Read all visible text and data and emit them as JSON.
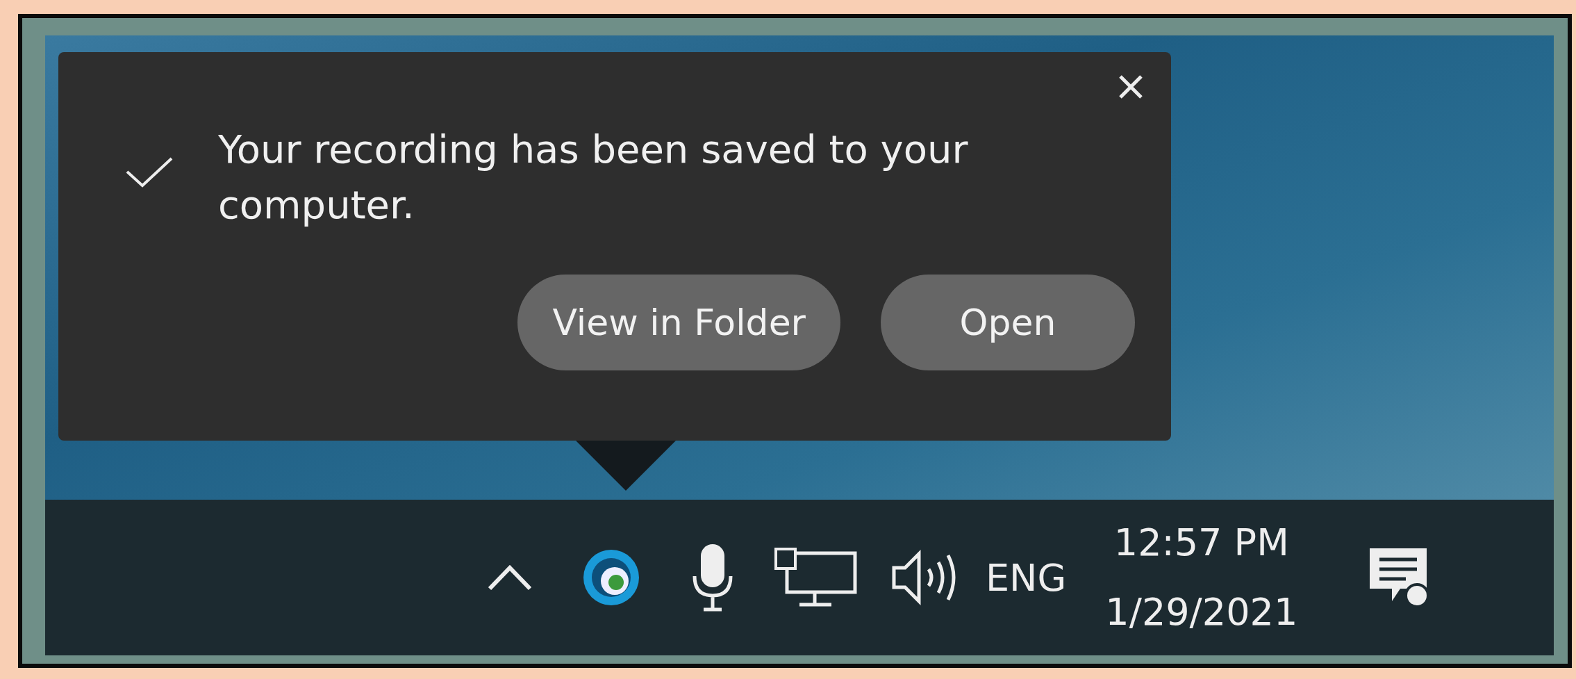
{
  "notification": {
    "message": "Your recording has been saved to your computer.",
    "buttons": [
      "View in Folder",
      "Open"
    ]
  },
  "taskbar": {
    "language": "ENG",
    "time": "12:57 PM",
    "date": "1/29/2021"
  }
}
